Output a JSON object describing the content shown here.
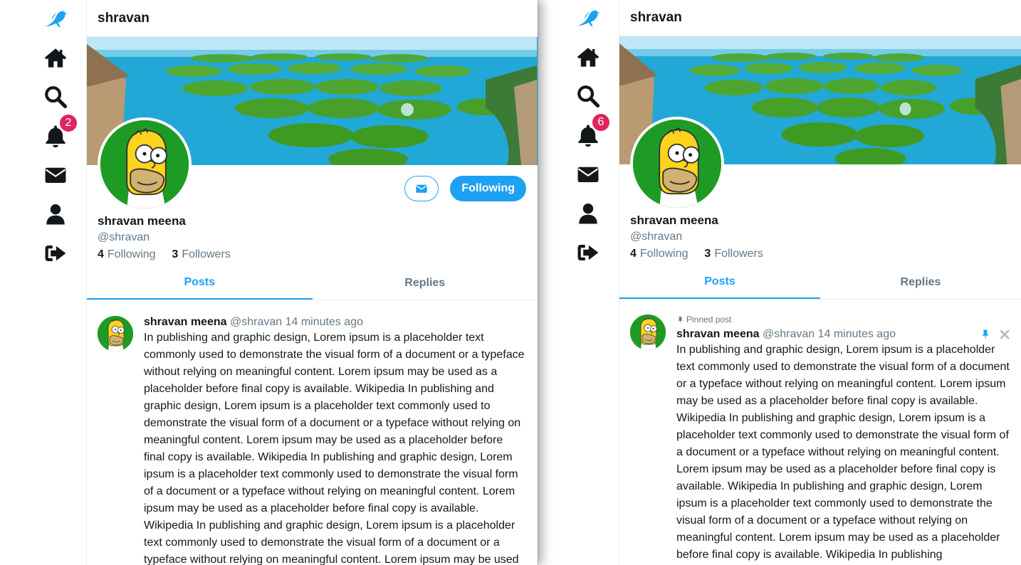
{
  "colors": {
    "accent": "#1da1f2",
    "badge": "#e0245e",
    "text": "#14171a",
    "muted": "#657786"
  },
  "sidebar_icons": [
    "bird-logo-icon",
    "home-icon",
    "search-icon",
    "bell-icon",
    "envelope-icon",
    "user-icon",
    "sign-out-icon"
  ],
  "left": {
    "header_title": "shravan",
    "notif_count": "2",
    "profile": {
      "name": "shravan meena",
      "handle": "@shravan",
      "following_count": "4",
      "following_label": "Following",
      "followers_count": "3",
      "followers_label": "Followers",
      "follow_button": "Following"
    },
    "tabs": {
      "posts": "Posts",
      "replies": "Replies"
    },
    "post": {
      "author": "shravan meena",
      "handle": "@shravan",
      "time": "14 minutes ago",
      "text": "In publishing and graphic design, Lorem ipsum is a placeholder text commonly used to demonstrate the visual form of a document or a typeface without relying on meaningful content. Lorem ipsum may be used as a placeholder before final copy is available. Wikipedia In publishing and graphic design, Lorem ipsum is a placeholder text commonly used to demonstrate the visual form of a document or a typeface without relying on meaningful content. Lorem ipsum may be used as a placeholder before final copy is available. Wikipedia In publishing and graphic design, Lorem ipsum is a placeholder text commonly used to demonstrate the visual form of a document or a typeface without relying on meaningful content. Lorem ipsum may be used as a placeholder before final copy is available. Wikipedia In publishing and graphic design, Lorem ipsum is a placeholder text commonly used to demonstrate the visual form of a document or a typeface without relying on meaningful content. Lorem ipsum may be used"
    }
  },
  "right": {
    "header_title": "shravan",
    "notif_count": "6",
    "profile": {
      "name": "shravan meena",
      "handle": "@shravan",
      "following_count": "4",
      "following_label": "Following",
      "followers_count": "3",
      "followers_label": "Followers"
    },
    "tabs": {
      "posts": "Posts",
      "replies": "Replies"
    },
    "post": {
      "pinned_label": "Pinned post",
      "author": "shravan meena",
      "handle": "@shravan",
      "time": "14 minutes ago",
      "text": "In publishing and graphic design, Lorem ipsum is a placeholder text commonly used to demonstrate the visual form of a document or a typeface without relying on meaningful content. Lorem ipsum may be used as a placeholder before final copy is available. Wikipedia In publishing and graphic design, Lorem ipsum is a placeholder text commonly used to demonstrate the visual form of a document or a typeface without relying on meaningful content. Lorem ipsum may be used as a placeholder before final copy is available. Wikipedia In publishing and graphic design, Lorem ipsum is a placeholder text commonly used to demonstrate the visual form of a document or a typeface without relying on meaningful content. Lorem ipsum may be used as a placeholder before final copy is available. Wikipedia In publishing"
    }
  }
}
